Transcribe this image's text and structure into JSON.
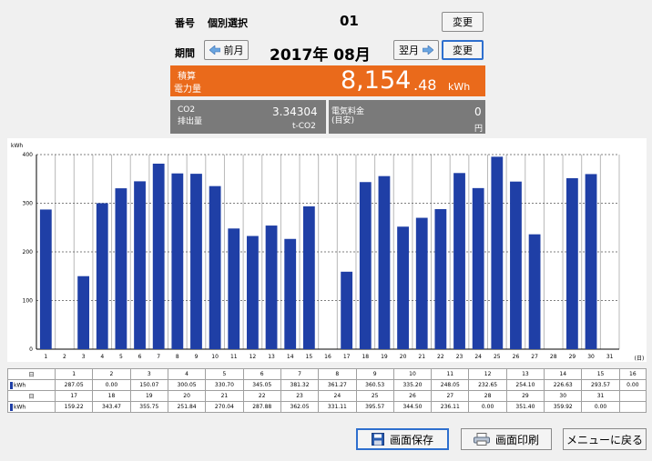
{
  "header": {
    "number_label": "番号",
    "number_sub": "個別選択",
    "number_value": "01",
    "change_label": "変更",
    "period_label": "期間",
    "prev_label": "前月",
    "period_value": "2017年 08月",
    "next_label": "翌月",
    "change2_label": "変更"
  },
  "summary": {
    "power_label_1": "積算",
    "power_label_2": "電力量",
    "power_int": "8,154",
    "power_dec": ".48",
    "power_unit": "kWh",
    "co2_label_1": "CO2",
    "co2_label_2": "排出量",
    "co2_value": "3.34304",
    "co2_unit": "t-CO2",
    "cost_label_1": "電気料金",
    "cost_label_2": "(目安)",
    "cost_value": "0",
    "cost_unit": "円"
  },
  "chart_data": {
    "type": "bar",
    "ylabel": "kWh",
    "xlabel": "(日)",
    "ylim": [
      0,
      400
    ],
    "yticks": [
      "0",
      "100",
      "200",
      "300",
      "400"
    ],
    "categories": [
      "1",
      "2",
      "3",
      "4",
      "5",
      "6",
      "7",
      "8",
      "9",
      "10",
      "11",
      "12",
      "13",
      "14",
      "15",
      "16",
      "17",
      "18",
      "19",
      "20",
      "21",
      "22",
      "23",
      "24",
      "25",
      "26",
      "27",
      "28",
      "29",
      "30",
      "31"
    ],
    "values": [
      287.05,
      0.0,
      150.07,
      300.05,
      330.7,
      345.05,
      381.32,
      361.27,
      360.53,
      335.2,
      248.05,
      232.65,
      254.1,
      226.63,
      293.57,
      0.0,
      159.22,
      343.47,
      355.75,
      251.84,
      270.04,
      287.88,
      362.05,
      331.11,
      395.57,
      344.5,
      236.11,
      0.0,
      351.4,
      359.92,
      0.0
    ],
    "bar_color": "#1f3fa6",
    "grid": true
  },
  "table": {
    "day_header": "日",
    "unit_label": "kWh",
    "row1_days": [
      "1",
      "2",
      "3",
      "4",
      "5",
      "6",
      "7",
      "8",
      "9",
      "10",
      "11",
      "12",
      "13",
      "14",
      "15",
      "16"
    ],
    "row1_vals": [
      "287.05",
      "0.00",
      "150.07",
      "300.05",
      "330.70",
      "345.05",
      "381.32",
      "361.27",
      "360.53",
      "335.20",
      "248.05",
      "232.65",
      "254.10",
      "226.63",
      "293.57",
      "0.00"
    ],
    "row2_days": [
      "17",
      "18",
      "19",
      "20",
      "21",
      "22",
      "23",
      "24",
      "25",
      "26",
      "27",
      "28",
      "29",
      "30",
      "31"
    ],
    "row2_vals": [
      "159.22",
      "343.47",
      "355.75",
      "251.84",
      "270.04",
      "287.88",
      "362.05",
      "331.11",
      "395.57",
      "344.50",
      "236.11",
      "0.00",
      "351.40",
      "359.92",
      "0.00"
    ]
  },
  "footer": {
    "save_label": "画面保存",
    "print_label": "画面印刷",
    "menu_label": "メニューに戻る"
  }
}
